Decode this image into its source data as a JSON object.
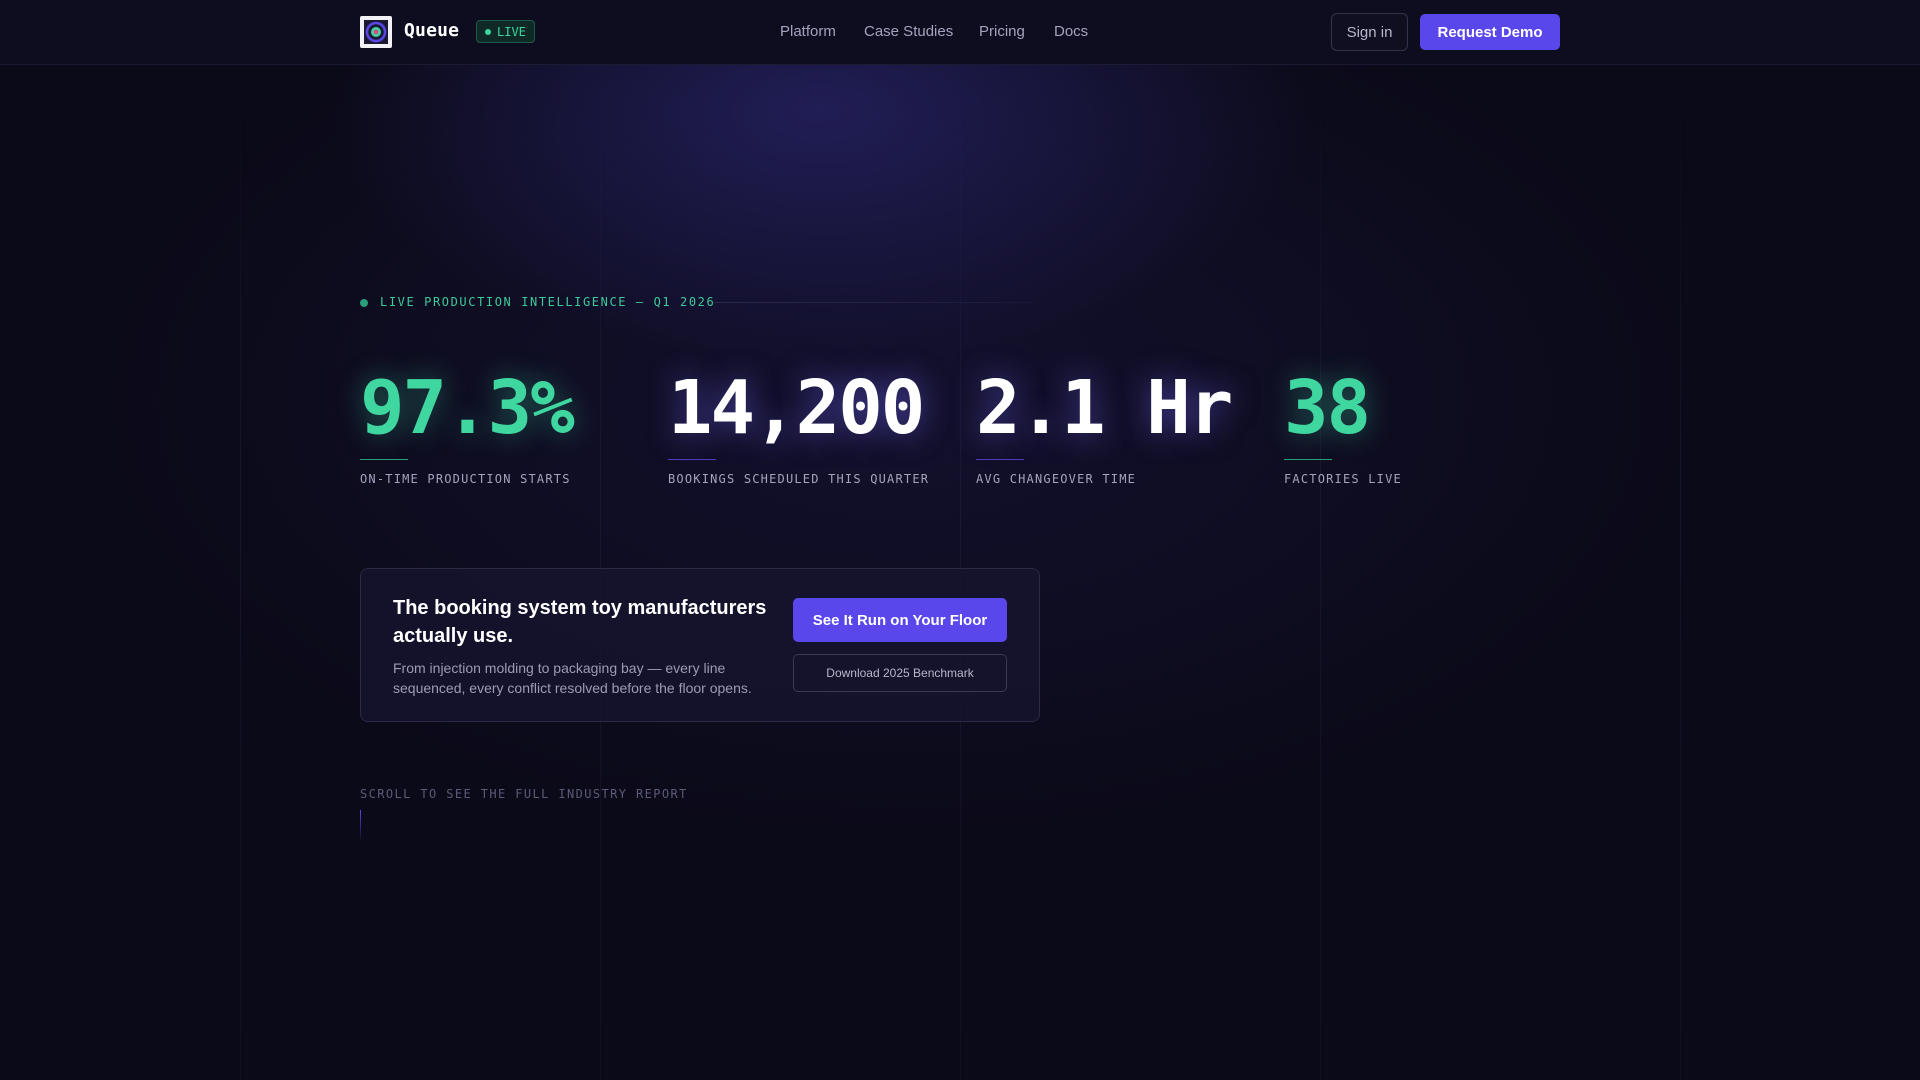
{
  "header": {
    "brand": "Queue",
    "live_badge": "LIVE",
    "nav": [
      "Platform",
      "Case Studies",
      "Pricing",
      "Docs"
    ],
    "signin_label": "Sign in",
    "demo_label": "Request Demo"
  },
  "hero": {
    "eyebrow": "LIVE PRODUCTION INTELLIGENCE — Q1 2026",
    "stats": [
      {
        "value": "97.3%",
        "label": "ON-TIME PRODUCTION STARTS"
      },
      {
        "value": "14,200",
        "label": "BOOKINGS SCHEDULED THIS QUARTER"
      },
      {
        "value": "2.1 Hr",
        "label": "AVG CHANGEOVER TIME"
      },
      {
        "value": "38",
        "label": "FACTORIES LIVE"
      }
    ]
  },
  "cta": {
    "title": "The booking system toy manufacturers actually use.",
    "subtitle": "From injection molding to packaging bay — every line sequenced, every conflict resolved before the floor opens.",
    "primary_label": "See It Run on Your Floor",
    "secondary_label": "Download 2025 Benchmark"
  },
  "scroll_hint": "SCROLL TO SEE THE FULL INDUSTRY REPORT",
  "colors": {
    "accent": "#5a47ec",
    "live_green": "#3fd6a0",
    "background": "#0b0a18"
  },
  "icons": {
    "logo": "queue-logo-icon",
    "live": "live-dot-icon"
  }
}
